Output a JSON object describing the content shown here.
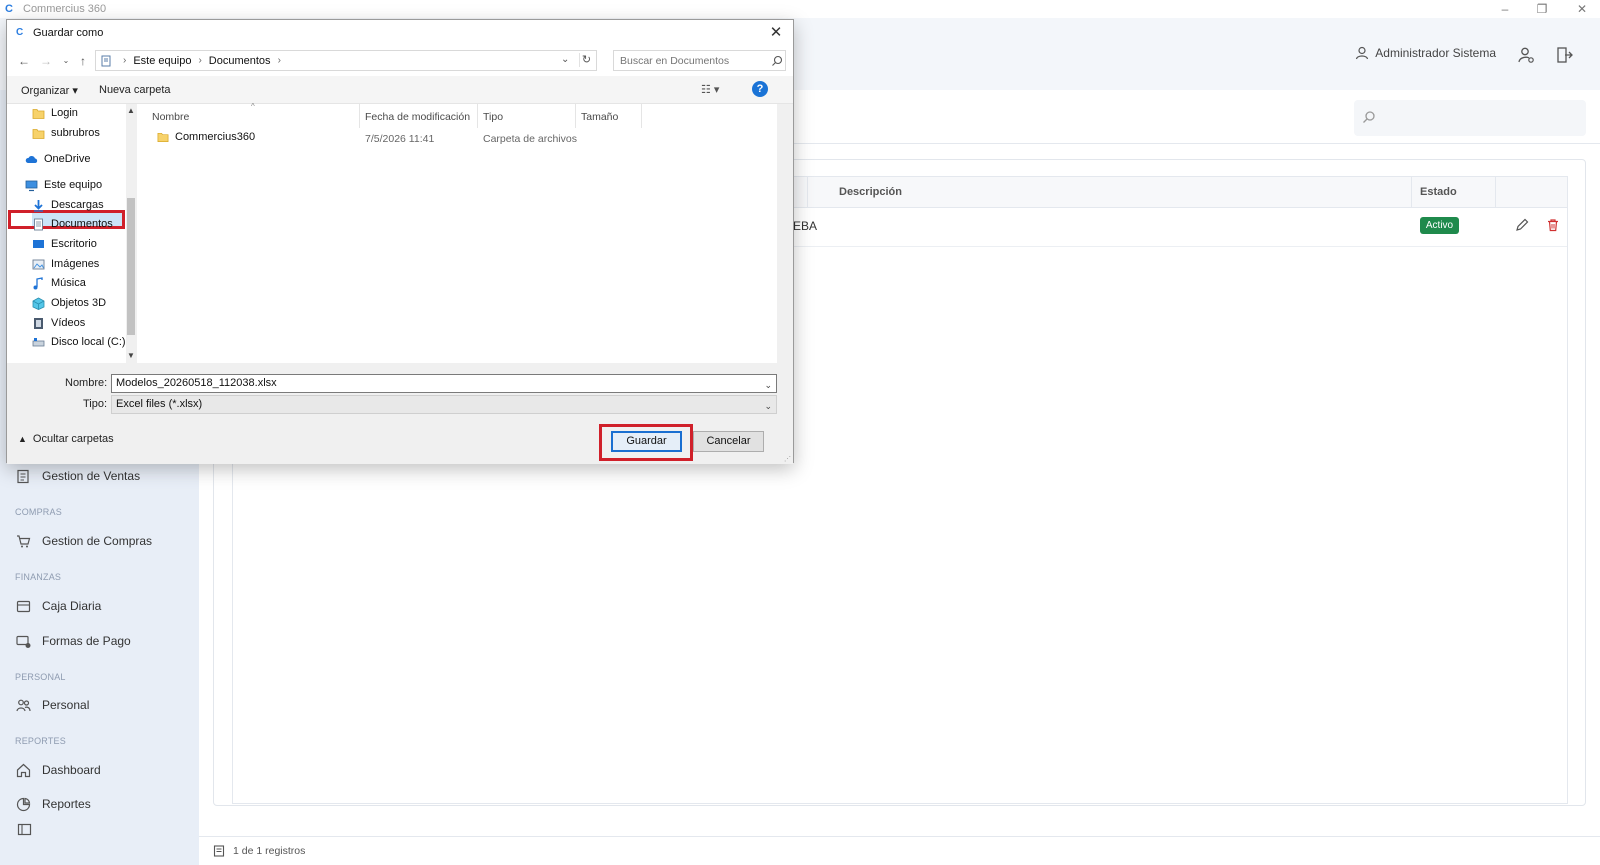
{
  "app": {
    "title": "Commercius 360",
    "logo_glyph": "C",
    "user_name": "Administrador Sistema",
    "brand_color": "#2b7de0"
  },
  "sidebar": {
    "sections": [
      {
        "label": "COMPRAS"
      },
      {
        "label": "FINANZAS"
      },
      {
        "label": "PERSONAL"
      },
      {
        "label": "REPORTES"
      }
    ],
    "items": [
      {
        "label": "Gestion de Ventas",
        "icon": "document-list-icon"
      },
      {
        "label": "Gestion de Compras",
        "icon": "cart-icon"
      },
      {
        "label": "Caja Diaria",
        "icon": "cash-box-icon"
      },
      {
        "label": "Formas de Pago",
        "icon": "payment-icon"
      },
      {
        "label": "Personal",
        "icon": "people-icon"
      },
      {
        "label": "Dashboard",
        "icon": "home-icon"
      },
      {
        "label": "Reportes",
        "icon": "reports-icon"
      }
    ]
  },
  "table": {
    "columns": [
      "Descripción",
      "Estado"
    ],
    "rows": [
      {
        "descripcion_visible": "EBA",
        "estado": "Activo"
      }
    ],
    "status_active_color": "#1f8a4c"
  },
  "footer": {
    "records": "1 de 1 registros"
  },
  "dialog": {
    "title": "Guardar como",
    "close_glyph": "✕",
    "breadcrumb": [
      "Este equipo",
      "Documentos"
    ],
    "search_placeholder": "Buscar en Documentos",
    "commands": {
      "organize": "Organizar",
      "new_folder": "Nueva carpeta"
    },
    "nav_items": [
      {
        "label": "Login",
        "icon": "folder-icon"
      },
      {
        "label": "subrubros",
        "icon": "folder-icon"
      },
      {
        "label": "OneDrive",
        "icon": "cloud-icon"
      },
      {
        "label": "Este equipo",
        "icon": "computer-icon"
      },
      {
        "label": "Descargas",
        "icon": "download-icon"
      },
      {
        "label": "Documentos",
        "icon": "documents-icon",
        "selected": true
      },
      {
        "label": "Escritorio",
        "icon": "desktop-icon"
      },
      {
        "label": "Imágenes",
        "icon": "images-icon"
      },
      {
        "label": "Música",
        "icon": "music-icon"
      },
      {
        "label": "Objetos 3D",
        "icon": "cube-icon"
      },
      {
        "label": "Vídeos",
        "icon": "video-icon"
      },
      {
        "label": "Disco local (C:)",
        "icon": "drive-icon"
      }
    ],
    "file_columns": [
      "Nombre",
      "Fecha de modificación",
      "Tipo",
      "Tamaño"
    ],
    "files": [
      {
        "name": "Commercius360",
        "modified": "7/5/2026 11:41",
        "type": "Carpeta de archivos",
        "size": ""
      }
    ],
    "name_label": "Nombre:",
    "name_value": "Modelos_20260518_112038.xlsx",
    "type_label": "Tipo:",
    "type_value": "Excel files (*.xlsx)",
    "hide_folders": "Ocultar carpetas",
    "save_button": "Guardar",
    "cancel_button": "Cancelar",
    "highlight_color": "#d0202a",
    "selection_color": "#cce4f7"
  }
}
